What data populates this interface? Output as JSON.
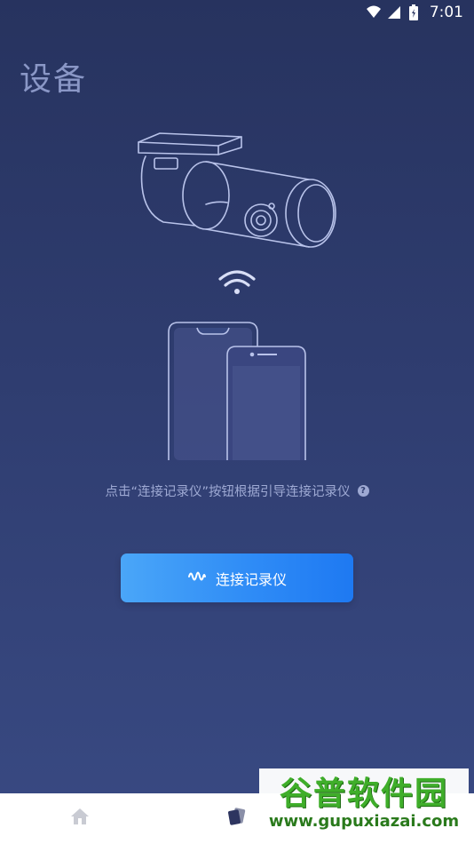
{
  "status_bar": {
    "time": "7:01",
    "icons": [
      "wifi-icon",
      "signal-icon",
      "battery-icon"
    ]
  },
  "page": {
    "title": "设备"
  },
  "hint": {
    "text": "点击“连接记录仪”按钮根据引导连接记录仪",
    "help_glyph": "?"
  },
  "connect_button": {
    "label": "连接记录仪",
    "icon": "sound-wave-icon"
  },
  "colors": {
    "accent": "#2f8cf6",
    "background_top": "#27335f",
    "background_bottom": "#394a83",
    "title": "#8a97c6",
    "hint_text": "#9ea9d3"
  },
  "bottom_nav": {
    "items": [
      {
        "icon": "home-icon"
      },
      {
        "icon": "device-cards-icon"
      }
    ]
  },
  "watermark": {
    "top": "谷普软件园",
    "bottom": "www.gupuxiazai.com"
  }
}
